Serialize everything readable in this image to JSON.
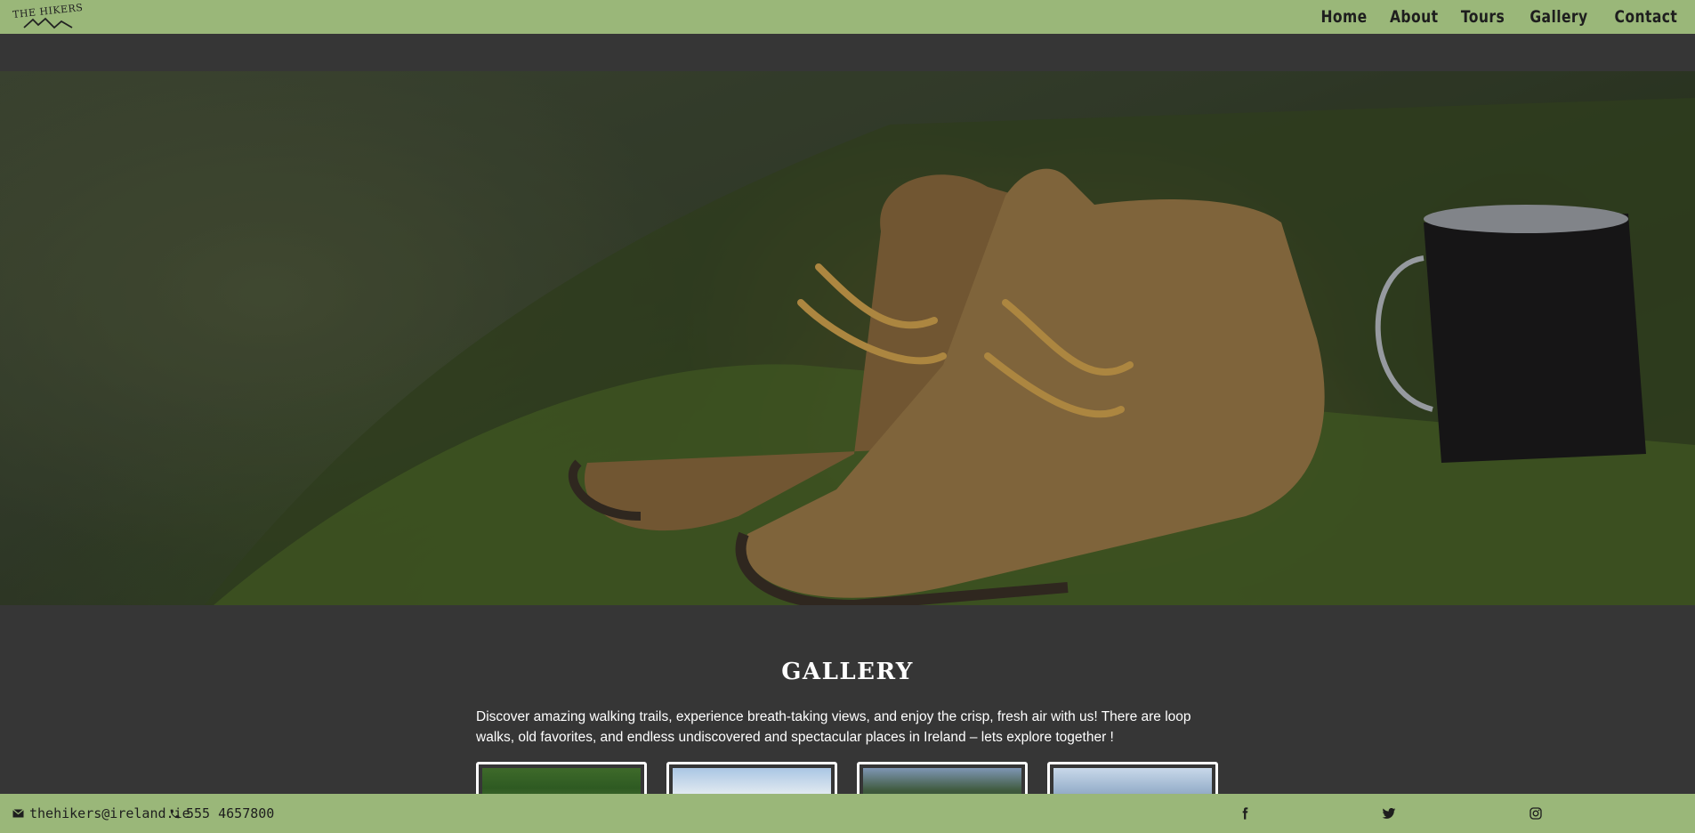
{
  "nav": {
    "logo_text": "THE HIKERS",
    "links": [
      "Home",
      "About",
      "Tours",
      "Gallery",
      "Contact"
    ]
  },
  "hero": {
    "image_desc": ""
  },
  "gallery": {
    "title": "GALLERY",
    "description": "Discover amazing walking trails, experience breath-taking views, and enjoy the crisp, fresh air with us! There are loop walks, old favorites, and endless undiscovered and spectacular places in Ireland – lets explore together !"
  },
  "footer": {
    "email": "thehikers@ireland.ie",
    "phone": "555 4657800",
    "social_icons": [
      "facebook-icon",
      "twitter-icon",
      "instagram-icon"
    ]
  },
  "colors": {
    "nav_bg": "#9ab779",
    "page_bg": "#363636",
    "text_light": "#ffffff",
    "text_dark": "#1e1e1e"
  }
}
